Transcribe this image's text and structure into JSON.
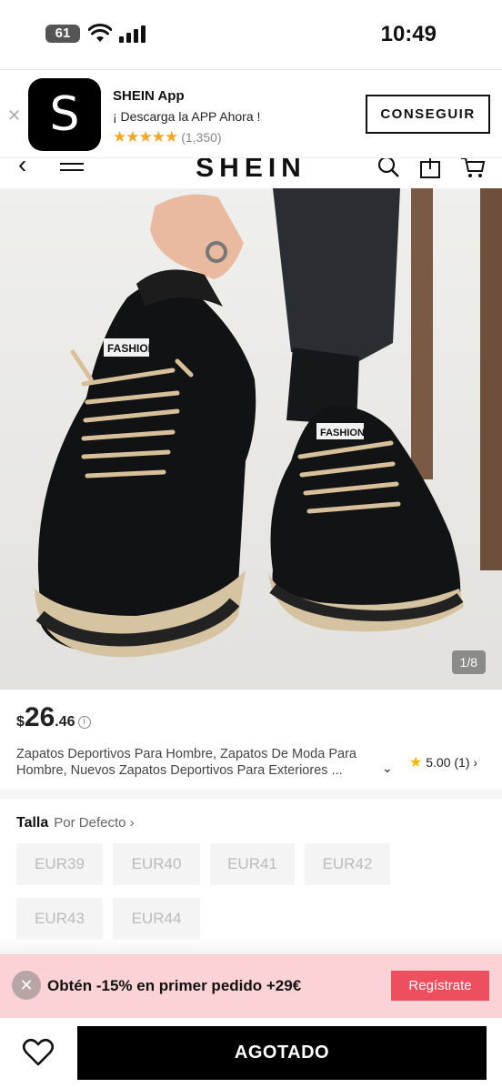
{
  "status_bar": {
    "battery": "61",
    "time": "10:49"
  },
  "app_banner": {
    "close": "✕",
    "icon_letter": "S",
    "name": "SHEIN App",
    "subtitle": "¡ Descarga la APP Ahora !",
    "stars": "★★★★★",
    "rating_count": "(1,350)",
    "get_label": "CONSEGUIR"
  },
  "header": {
    "back": "‹",
    "logo": "SHEIN"
  },
  "product": {
    "image_counter": "1/8",
    "price_currency": "$",
    "price_main": "26",
    "price_cents": ".46",
    "title_line1": "Zapatos Deportivos Para Hombre, Zapatos De Moda Para",
    "title_line2": "Hombre, Nuevos Zapatos Deportivos Para Exteriores ...",
    "rating_value": "5.00",
    "rating_count": "(1)",
    "rating_chevron": "›",
    "title_chevron": "⌄",
    "star": "★"
  },
  "sizes": {
    "label": "Talla",
    "default_label": "Por Defecto ›",
    "options": [
      "EUR39",
      "EUR40",
      "EUR41",
      "EUR42",
      "EUR43",
      "EUR44"
    ]
  },
  "promo": {
    "close": "✕",
    "text": "Obtén -15% en primer pedido +29€",
    "register_label": "Regístrate",
    "accent_color": "#ee4f5f",
    "background_color": "#fbd3d6"
  },
  "bottom_bar": {
    "soldout_label": "AGOTADO"
  }
}
